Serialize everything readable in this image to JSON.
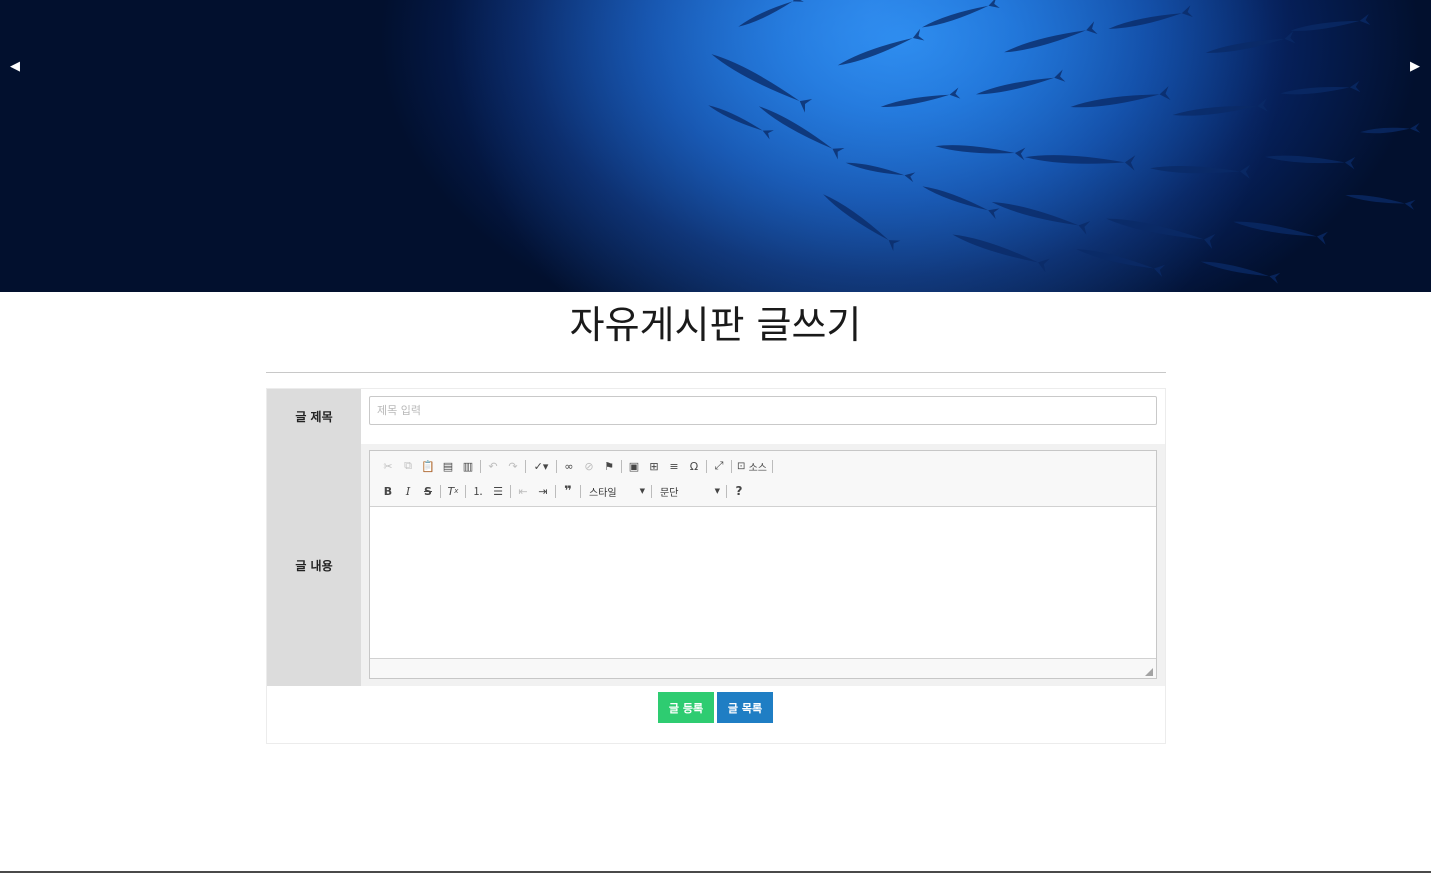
{
  "banner": {
    "prev_glyph": "◀",
    "next_glyph": "▶",
    "image_icon": "school-of-fish-underwater-image"
  },
  "page": {
    "title": "자유게시판 글쓰기"
  },
  "form": {
    "title_label": "글 제목",
    "title_placeholder": "제목 입력",
    "title_value": "",
    "content_label": "글 내용",
    "content_value": "",
    "submit_label": "글 등록",
    "list_label": "글 목록"
  },
  "editor": {
    "source_label": "소스",
    "style_combo": "스타일",
    "paragraph_combo": "문단",
    "help_glyph": "?"
  },
  "colors": {
    "submit_button": "#2ecc71",
    "list_button": "#1f7ec4",
    "label_bg": "#dcdcdc",
    "banner_deep": "#02102e",
    "banner_light": "#1e7ee0"
  }
}
